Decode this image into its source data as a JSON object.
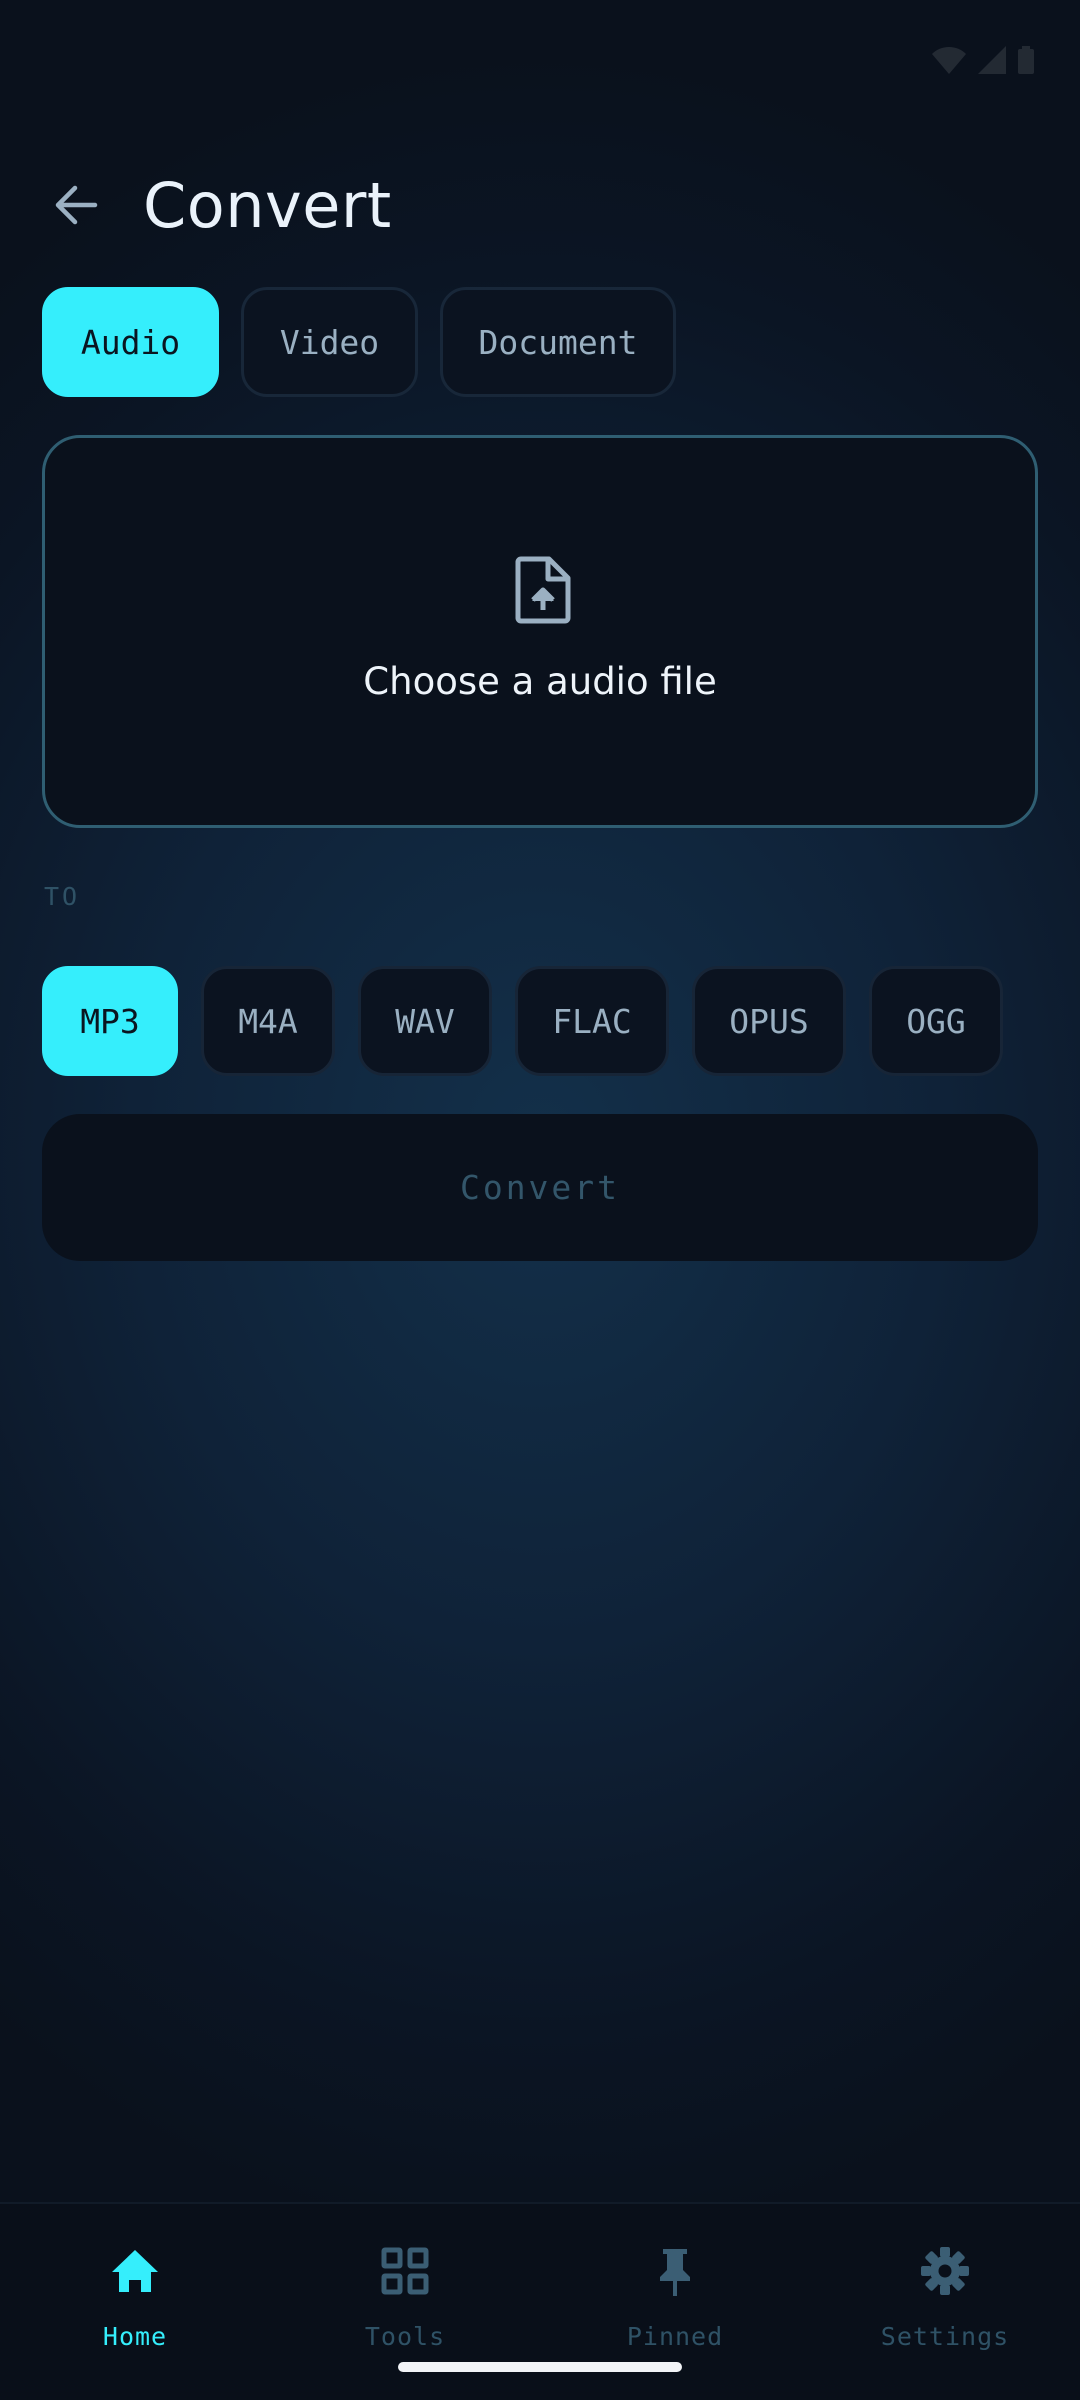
{
  "header": {
    "title": "Convert",
    "back_icon": "arrow-left-icon"
  },
  "category_tabs": [
    {
      "label": "Audio",
      "active": true
    },
    {
      "label": "Video",
      "active": false
    },
    {
      "label": "Document",
      "active": false
    }
  ],
  "file_picker": {
    "icon": "file-upload-icon",
    "label": "Choose a audio file"
  },
  "target": {
    "label": "TO",
    "formats": [
      {
        "label": "MP3",
        "active": true
      },
      {
        "label": "M4A",
        "active": false
      },
      {
        "label": "WAV",
        "active": false
      },
      {
        "label": "FLAC",
        "active": false
      },
      {
        "label": "OPUS",
        "active": false
      },
      {
        "label": "OGG",
        "active": false
      }
    ]
  },
  "convert_button": {
    "label": "Convert",
    "enabled": false
  },
  "bottom_nav": [
    {
      "label": "Home",
      "icon": "home-icon",
      "active": true
    },
    {
      "label": "Tools",
      "icon": "grid-icon",
      "active": false
    },
    {
      "label": "Pinned",
      "icon": "pin-icon",
      "active": false
    },
    {
      "label": "Settings",
      "icon": "gear-icon",
      "active": false
    }
  ],
  "colors": {
    "accent": "#35eefc",
    "background": "#0b1524",
    "muted_text": "#9ab0c2"
  }
}
